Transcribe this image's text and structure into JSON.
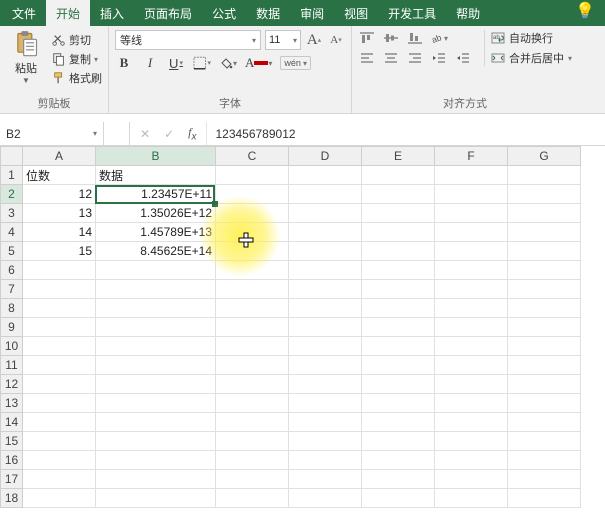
{
  "tabs": {
    "file": "文件",
    "home": "开始",
    "insert": "插入",
    "layout": "页面布局",
    "formulas": "公式",
    "data": "数据",
    "review": "审阅",
    "view": "视图",
    "dev": "开发工具",
    "help": "帮助"
  },
  "ribbon": {
    "clipboard": {
      "paste": "粘贴",
      "cut": "剪切",
      "copy": "复制",
      "format_painter": "格式刷",
      "label": "剪贴板"
    },
    "font": {
      "name": "等线",
      "size": "11",
      "bold": "B",
      "italic": "I",
      "underline": "U",
      "wen": "wén",
      "label": "字体"
    },
    "align": {
      "wrap": "自动换行",
      "merge": "合并后居中",
      "label": "对齐方式"
    }
  },
  "name_box": "B2",
  "formula": "123456789012",
  "columns": [
    "A",
    "B",
    "C",
    "D",
    "E",
    "F",
    "G"
  ],
  "rows": [
    "1",
    "2",
    "3",
    "4",
    "5",
    "6",
    "7",
    "8",
    "9",
    "10",
    "11",
    "12",
    "13",
    "14",
    "15",
    "16",
    "17",
    "18"
  ],
  "sheet": {
    "A1": "位数",
    "B1": "数据",
    "A2": "12",
    "A3": "13",
    "A4": "14",
    "A5": "15",
    "B2": "1.23457E+11",
    "B3": "1.35026E+12",
    "B4": "1.45789E+13",
    "B5": "8.45625E+14"
  },
  "chart_data": {
    "type": "table",
    "columns": [
      "位数",
      "数据"
    ],
    "rows": [
      {
        "位数": 12,
        "数据": 123457000000.0
      },
      {
        "位数": 13,
        "数据": 1350260000000.0
      },
      {
        "位数": 14,
        "数据": 14578900000000.0
      },
      {
        "位数": 15,
        "数据": 845625000000000.0
      }
    ]
  }
}
